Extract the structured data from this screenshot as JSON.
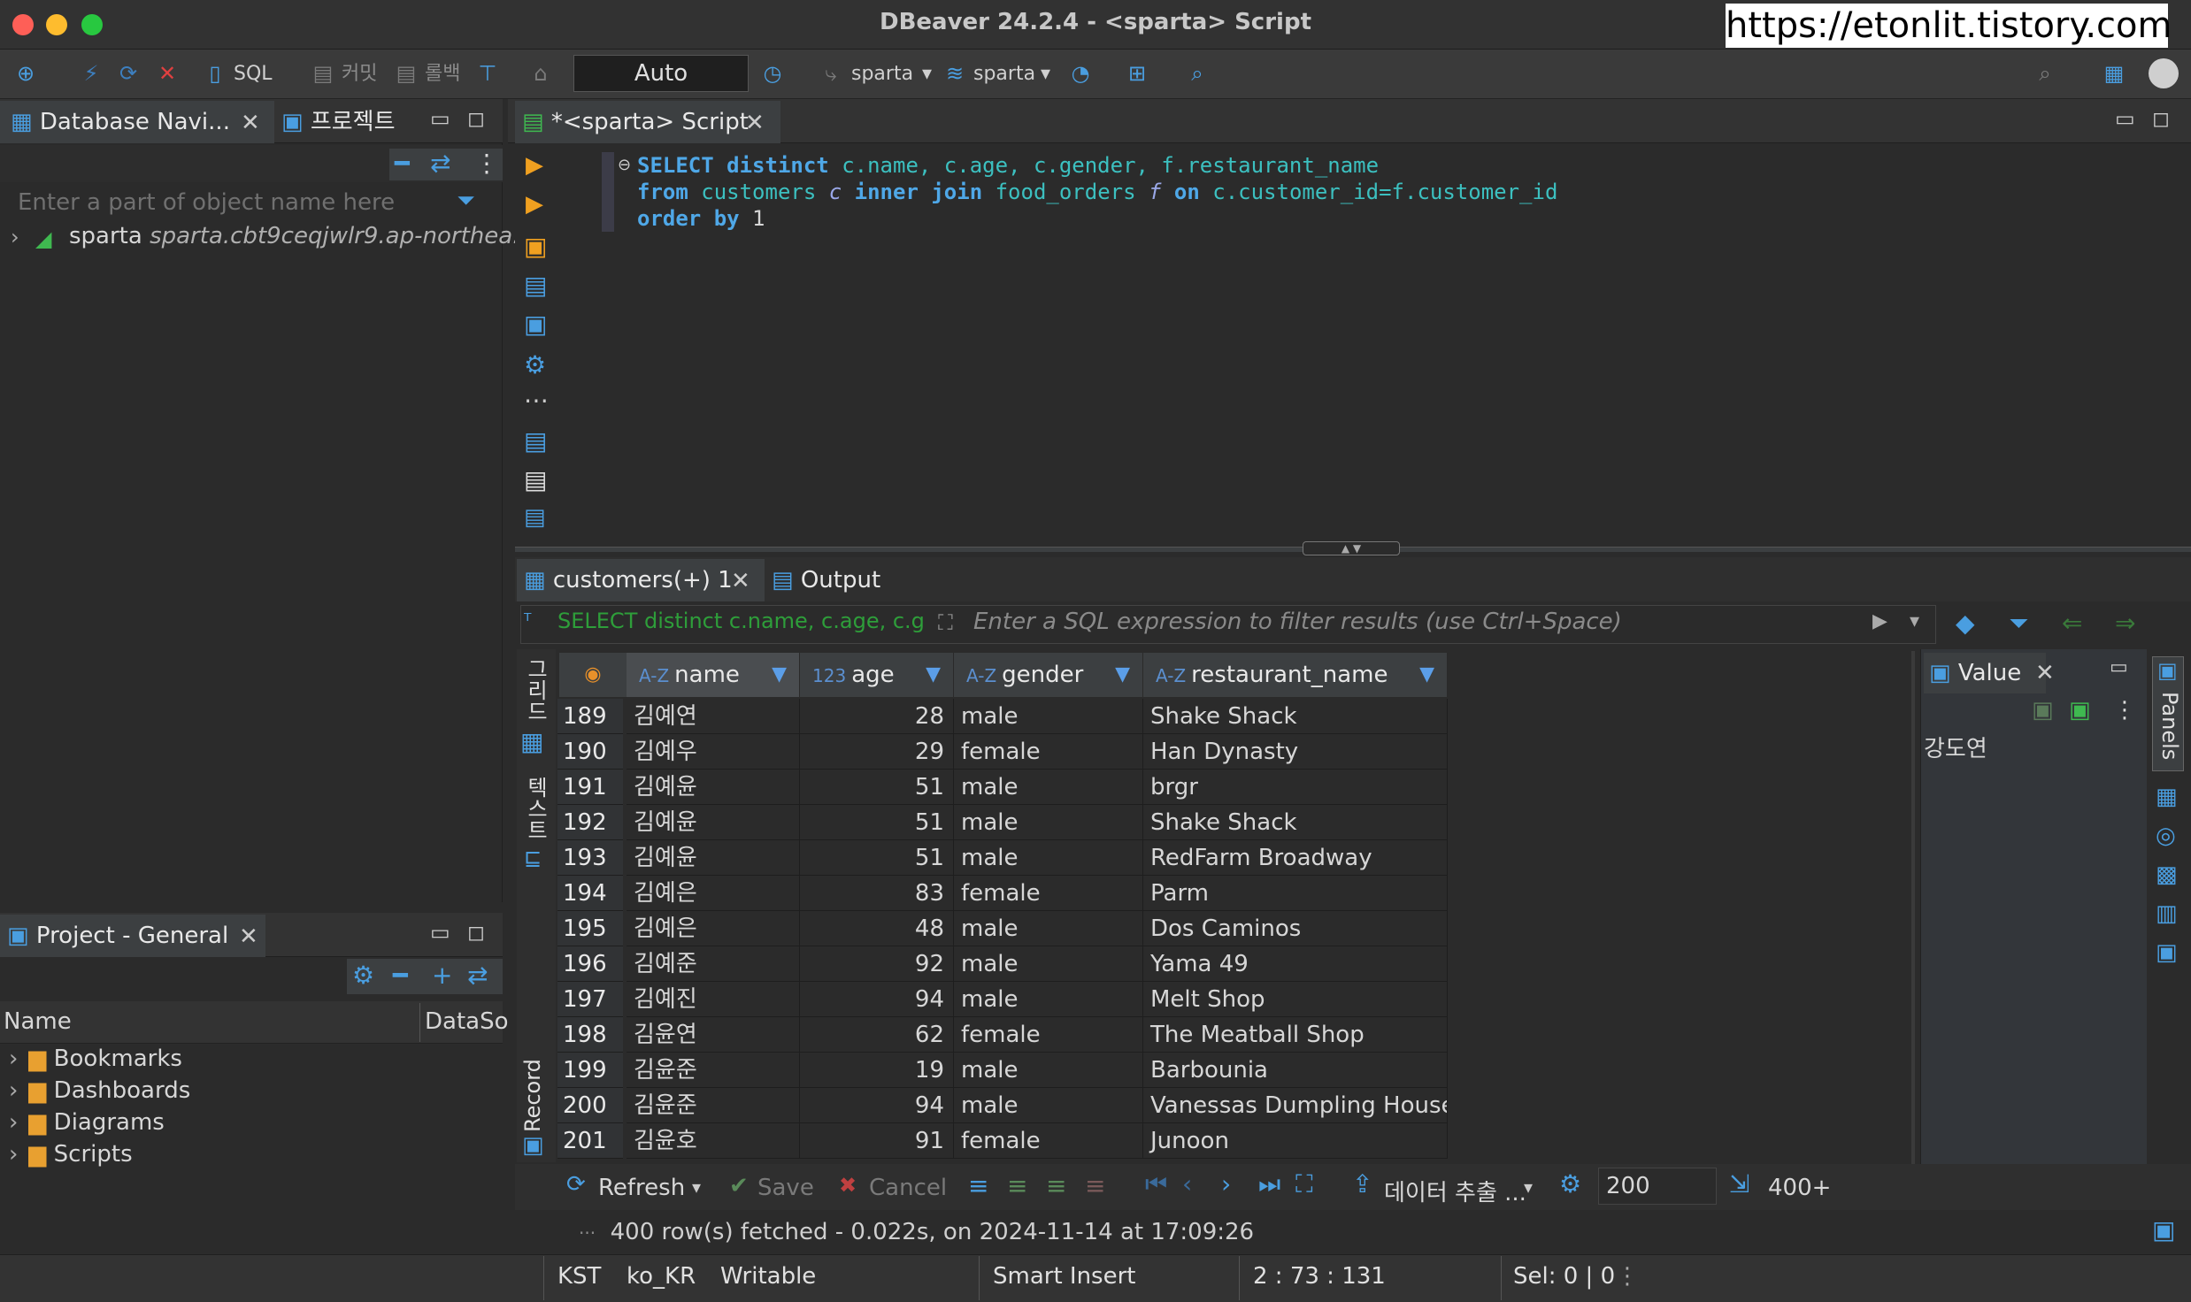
{
  "window": {
    "title": "DBeaver 24.2.4 - <sparta> Script",
    "watermark": "https://etonlit.tistory.com"
  },
  "toolbar": {
    "sql_label": "SQL",
    "commit_label": "커밋",
    "rollback_label": "롤백",
    "tx_mode": "Auto",
    "datasource": "sparta",
    "schema": "sparta"
  },
  "nav": {
    "tab_label": "Database Navi...",
    "projects_tab_label": "프로젝트",
    "search_placeholder": "Enter a part of object name here",
    "connection_name": "sparta",
    "connection_host": "sparta.cbt9ceqjwlr9.ap-northea..."
  },
  "project": {
    "tab_label": "Project - General",
    "col_name": "Name",
    "col_datasource": "DataSo",
    "items": [
      {
        "label": "Bookmarks"
      },
      {
        "label": "Dashboards"
      },
      {
        "label": "Diagrams"
      },
      {
        "label": "Scripts"
      }
    ]
  },
  "editor": {
    "tab_label": "*<sparta> Script",
    "lines": {
      "l1": {
        "kw1": "SELECT",
        "kw2": "distinct",
        "rest": " c.name, c.age, c.gender, f.restaurant_name"
      },
      "l2": {
        "kw1": "from",
        "t1": " customers ",
        "a1": "c",
        "kw2": " inner join",
        "t2": " food_orders ",
        "a2": "f",
        "kw3": " on",
        "rest": " c.customer_id=f.customer_id"
      },
      "l3": {
        "kw1": "order by",
        "num": " 1"
      }
    }
  },
  "results": {
    "tab_label": "customers(+) 1",
    "output_tab_label": "Output",
    "filter_query": "SELECT distinct c.name, c.age, c.g",
    "filter_placeholder": "Enter a SQL expression to filter results (use Ctrl+Space)",
    "side_grid_label": "그리드",
    "side_text_label": "텍스트",
    "side_record_label": "Record",
    "columns": [
      {
        "type": "A-Z",
        "label": "name"
      },
      {
        "type": "123",
        "label": "age"
      },
      {
        "type": "A-Z",
        "label": "gender"
      },
      {
        "type": "A-Z",
        "label": "restaurant_name"
      }
    ],
    "rows": [
      {
        "n": "189",
        "name": "김예연",
        "age": "28",
        "gender": "male",
        "restaurant": "Shake Shack"
      },
      {
        "n": "190",
        "name": "김예우",
        "age": "29",
        "gender": "female",
        "restaurant": "Han Dynasty"
      },
      {
        "n": "191",
        "name": "김예윤",
        "age": "51",
        "gender": "male",
        "restaurant": "brgr"
      },
      {
        "n": "192",
        "name": "김예윤",
        "age": "51",
        "gender": "male",
        "restaurant": "Shake Shack"
      },
      {
        "n": "193",
        "name": "김예윤",
        "age": "51",
        "gender": "male",
        "restaurant": "RedFarm Broadway"
      },
      {
        "n": "194",
        "name": "김예은",
        "age": "83",
        "gender": "female",
        "restaurant": "Parm"
      },
      {
        "n": "195",
        "name": "김예은",
        "age": "48",
        "gender": "male",
        "restaurant": "Dos Caminos"
      },
      {
        "n": "196",
        "name": "김예준",
        "age": "92",
        "gender": "male",
        "restaurant": "Yama 49"
      },
      {
        "n": "197",
        "name": "김예진",
        "age": "94",
        "gender": "male",
        "restaurant": "Melt Shop"
      },
      {
        "n": "198",
        "name": "김윤연",
        "age": "62",
        "gender": "female",
        "restaurant": "The Meatball Shop"
      },
      {
        "n": "199",
        "name": "김윤준",
        "age": "19",
        "gender": "male",
        "restaurant": "Barbounia"
      },
      {
        "n": "200",
        "name": "김윤준",
        "age": "94",
        "gender": "male",
        "restaurant": "Vanessas Dumpling House"
      },
      {
        "n": "201",
        "name": "김윤호",
        "age": "91",
        "gender": "female",
        "restaurant": "Junoon"
      }
    ],
    "value_panel": {
      "tab_label": "Value",
      "value": "강도연",
      "panels_label": "Panels"
    },
    "bottom": {
      "refresh": "Refresh",
      "save": "Save",
      "cancel": "Cancel",
      "export": "데이터 추출 ...",
      "fetch_size": "200",
      "row_count": "400+",
      "status": "400 row(s) fetched - 0.022s, on 2024-11-14 at 17:09:26"
    }
  },
  "statusbar": {
    "tz": "KST",
    "locale": "ko_KR",
    "mode": "Writable",
    "insert": "Smart Insert",
    "pos": "2 : 73 : 131",
    "sel": "Sel: 0 | 0"
  }
}
